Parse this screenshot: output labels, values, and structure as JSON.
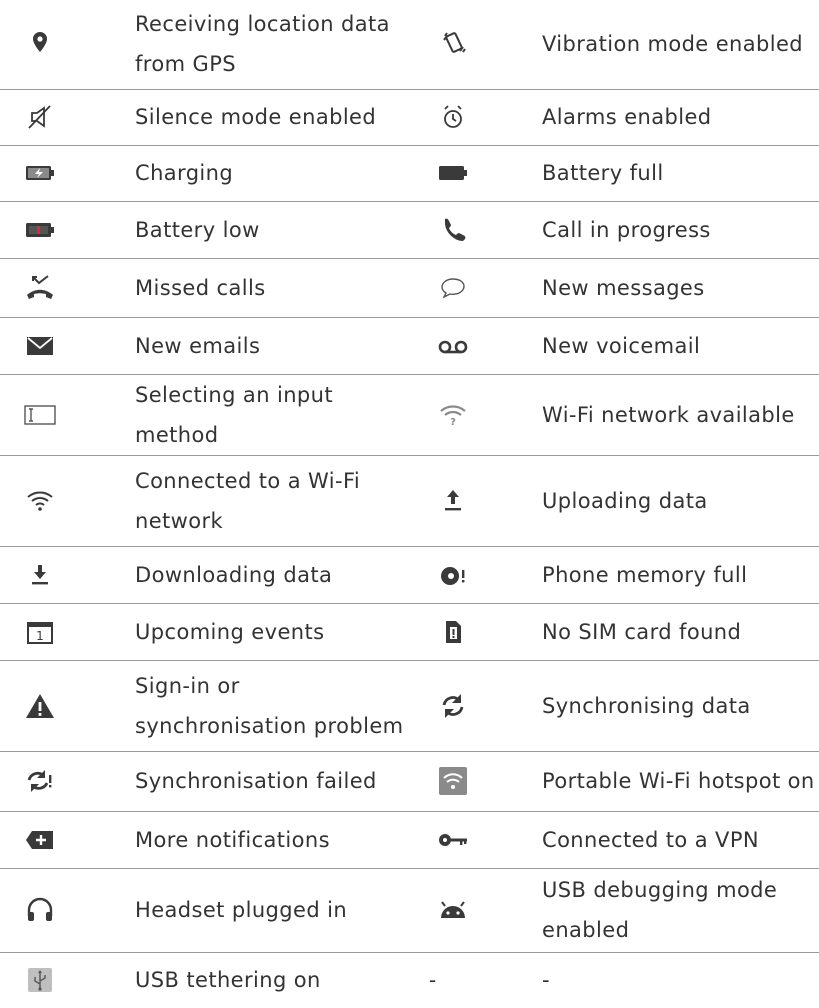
{
  "rows": [
    {
      "left": {
        "icon": "location-pin-icon",
        "label": "Receiving location data from GPS"
      },
      "right": {
        "icon": "vibration-icon",
        "label": "Vibration mode enabled"
      }
    },
    {
      "left": {
        "icon": "silent-mode-icon",
        "label": "Silence mode enabled"
      },
      "right": {
        "icon": "alarm-clock-icon",
        "label": "Alarms enabled"
      }
    },
    {
      "left": {
        "icon": "battery-charging-icon",
        "label": "Charging"
      },
      "right": {
        "icon": "battery-full-icon",
        "label": "Battery full"
      }
    },
    {
      "left": {
        "icon": "battery-low-icon",
        "label": "Battery low"
      },
      "right": {
        "icon": "phone-call-icon",
        "label": "Call in progress"
      }
    },
    {
      "left": {
        "icon": "missed-call-icon",
        "label": "Missed calls"
      },
      "right": {
        "icon": "message-bubble-icon",
        "label": "New messages"
      }
    },
    {
      "left": {
        "icon": "envelope-icon",
        "label": "New emails"
      },
      "right": {
        "icon": "voicemail-icon",
        "label": "New voicemail"
      }
    },
    {
      "left": {
        "icon": "input-method-icon",
        "label": "Selecting an input method"
      },
      "right": {
        "icon": "wifi-available-icon",
        "label": "Wi-Fi network available"
      }
    },
    {
      "left": {
        "icon": "wifi-connected-icon",
        "label": "Connected to a Wi-Fi network"
      },
      "right": {
        "icon": "upload-icon",
        "label": "Uploading data"
      }
    },
    {
      "left": {
        "icon": "download-icon",
        "label": "Downloading data"
      },
      "right": {
        "icon": "memory-full-icon",
        "label": "Phone memory full"
      }
    },
    {
      "left": {
        "icon": "calendar-icon",
        "label": "Upcoming events"
      },
      "right": {
        "icon": "no-sim-icon",
        "label": "No SIM card found"
      }
    },
    {
      "left": {
        "icon": "warning-triangle-icon",
        "label": "Sign-in or synchronisation problem"
      },
      "right": {
        "icon": "sync-icon",
        "label": "Synchronising data"
      }
    },
    {
      "left": {
        "icon": "sync-failed-icon",
        "label": "Synchronisation failed"
      },
      "right": {
        "icon": "hotspot-icon",
        "label": "Portable Wi-Fi hotspot on"
      }
    },
    {
      "left": {
        "icon": "more-notifications-icon",
        "label": "More notifications"
      },
      "right": {
        "icon": "vpn-key-icon",
        "label": "Connected to a VPN"
      }
    },
    {
      "left": {
        "icon": "headset-icon",
        "label": "Headset plugged in"
      },
      "right": {
        "icon": "android-icon",
        "label": "USB debugging mode enabled"
      }
    },
    {
      "left": {
        "icon": "usb-icon",
        "label": "USB tethering on"
      },
      "right": {
        "icon": "",
        "label": "-",
        "icon_text": "-"
      }
    }
  ]
}
